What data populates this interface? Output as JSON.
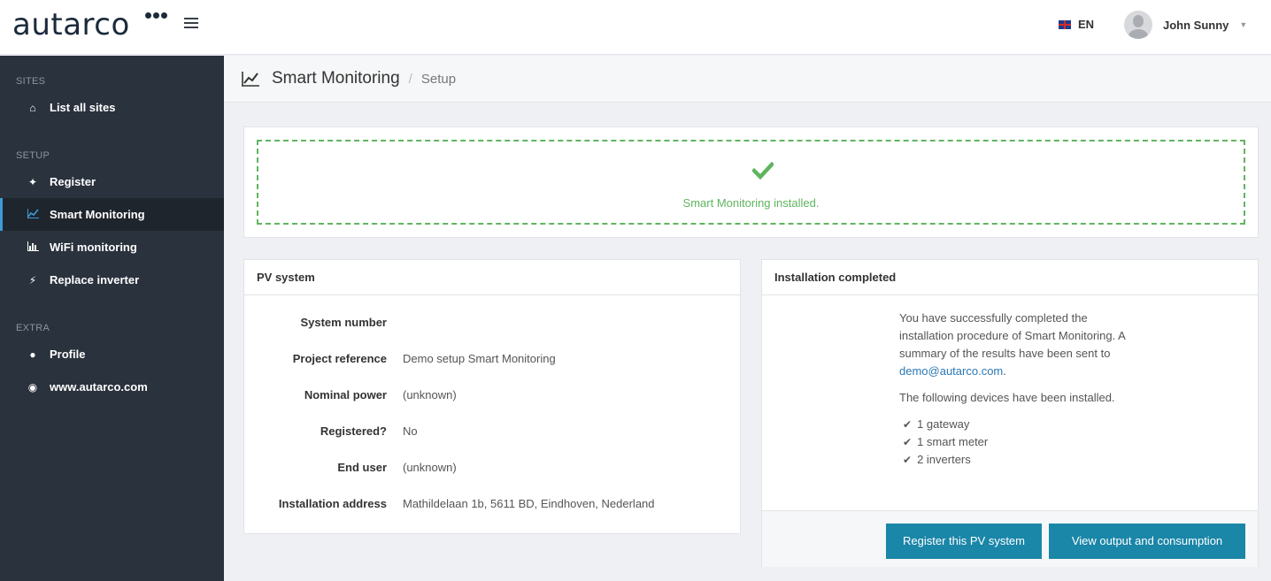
{
  "brand": {
    "logo_text": "autarco"
  },
  "header": {
    "language": "EN",
    "user_name": "John Sunny"
  },
  "sidebar": {
    "sections": [
      {
        "label": "SITES",
        "items": [
          {
            "label": "List all sites",
            "icon": "home-icon"
          }
        ]
      },
      {
        "label": "SETUP",
        "items": [
          {
            "label": "Register",
            "icon": "plug-icon"
          },
          {
            "label": "Smart Monitoring",
            "icon": "line-chart-icon",
            "active": true
          },
          {
            "label": "WiFi monitoring",
            "icon": "bar-chart-icon"
          },
          {
            "label": "Replace inverter",
            "icon": "bolt-icon"
          }
        ]
      },
      {
        "label": "EXTRA",
        "items": [
          {
            "label": "Profile",
            "icon": "person-icon"
          },
          {
            "label": "www.autarco.com",
            "icon": "globe-icon"
          }
        ]
      }
    ]
  },
  "page": {
    "title": "Smart Monitoring",
    "breadcrumb_sep": "/",
    "breadcrumb": "Setup"
  },
  "success": {
    "message": "Smart Monitoring installed."
  },
  "pv_system": {
    "heading": "PV system",
    "rows": [
      {
        "label": "System number",
        "value": ""
      },
      {
        "label": "Project reference",
        "value": "Demo setup Smart Monitoring"
      },
      {
        "label": "Nominal power",
        "value": "(unknown)"
      },
      {
        "label": "Registered?",
        "value": "No"
      },
      {
        "label": "End user",
        "value": "(unknown)"
      },
      {
        "label": "Installation address",
        "value": "Mathildelaan 1b, 5611 BD, Eindhoven, Nederland"
      }
    ]
  },
  "installation": {
    "heading": "Installation completed",
    "intro": "You have successfully completed the installation procedure of Smart Monitoring. A summary of the results have been sent to",
    "email": "demo@autarco.com",
    "intro_end": ".",
    "devices_intro": "The following devices have been installed.",
    "devices": [
      "1 gateway",
      "1 smart meter",
      "2 inverters"
    ],
    "btn_register": "Register this PV system",
    "btn_view": "View output and consumption"
  },
  "colors": {
    "sidebar_bg": "#2a323d",
    "accent": "#3d9bd6",
    "success": "#5fb55f",
    "button": "#1a86a8"
  }
}
